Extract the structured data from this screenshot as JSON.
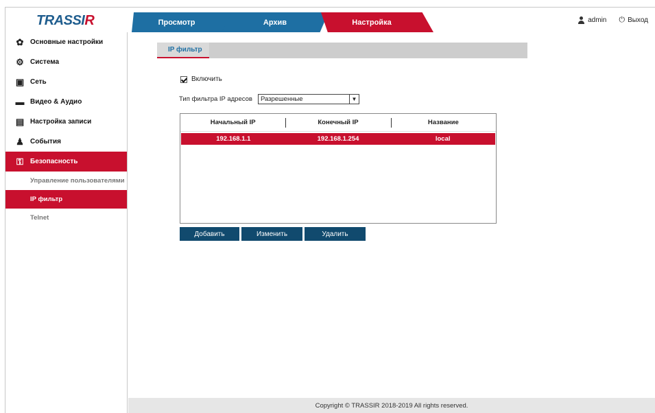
{
  "header": {
    "logo_main": "TRASSI",
    "logo_accent": "R",
    "tabs": [
      {
        "label": "Просмотр"
      },
      {
        "label": "Архив"
      },
      {
        "label": "Настройка"
      }
    ],
    "user": "admin",
    "logout": "Выход"
  },
  "sidebar": {
    "items": [
      {
        "label": "Основные настройки",
        "icon": "gear-icon"
      },
      {
        "label": "Система",
        "icon": "gears-icon"
      },
      {
        "label": "Сеть",
        "icon": "network-icon"
      },
      {
        "label": "Видео & Аудио",
        "icon": "clapperboard-icon"
      },
      {
        "label": "Настройка записи",
        "icon": "floppy-icon"
      },
      {
        "label": "События",
        "icon": "events-icon"
      },
      {
        "label": "Безопасность",
        "icon": "lock-icon"
      }
    ],
    "subitems": [
      {
        "label": "Управление пользователями"
      },
      {
        "label": "IP фильтр"
      },
      {
        "label": "Telnet"
      }
    ]
  },
  "main": {
    "section_tab": "IP фильтр",
    "enable_label": "Включить",
    "enable_checked": true,
    "filter_type_label": "Тип фильтра IP адресов",
    "filter_type_value": "Разрешенные",
    "table": {
      "columns": [
        "Начальный IP",
        "Конечный IP",
        "Название"
      ],
      "rows": [
        [
          "192.168.1.1",
          "192.168.1.254",
          "local"
        ]
      ]
    },
    "buttons": {
      "add": "Добавить",
      "edit": "Изменить",
      "delete": "Удалить"
    }
  },
  "footer": {
    "copyright": "Copyright © TRASSIR 2018-2019 All rights reserved."
  },
  "colors": {
    "brand_blue": "#1e6fa3",
    "brand_red": "#c8102e",
    "button_blue": "#114a6e"
  }
}
